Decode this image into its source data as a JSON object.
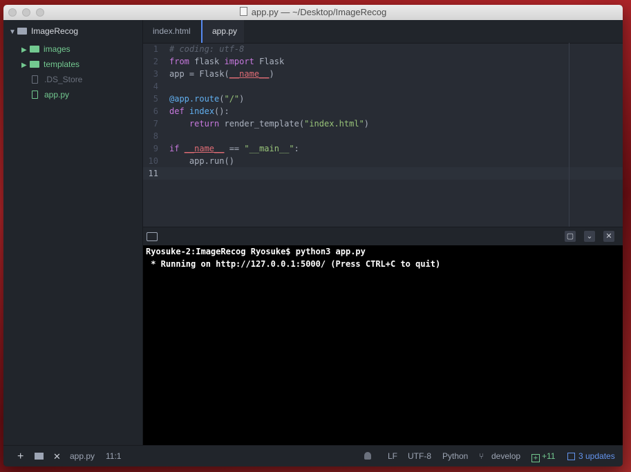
{
  "window": {
    "title": "app.py — ~/Desktop/ImageRecog"
  },
  "tree": {
    "root": "ImageRecog",
    "items": [
      {
        "label": "images",
        "type": "folder"
      },
      {
        "label": "templates",
        "type": "folder"
      },
      {
        "label": ".DS_Store",
        "type": "file"
      },
      {
        "label": "app.py",
        "type": "file"
      }
    ]
  },
  "tabs": [
    {
      "label": "index.html",
      "active": false
    },
    {
      "label": "app.py",
      "active": true
    }
  ],
  "editor": {
    "line_numbers": [
      "1",
      "2",
      "3",
      "4",
      "5",
      "6",
      "7",
      "8",
      "9",
      "10",
      "11"
    ],
    "current_line": "11"
  },
  "terminal": {
    "lines": [
      "Ryosuke-2:ImageRecog Ryosuke$ python3 app.py",
      " * Running on http://127.0.0.1:5000/ (Press CTRL+C to quit)"
    ]
  },
  "status": {
    "file": "app.py",
    "cursor": "11:1",
    "line_ending": "LF",
    "encoding": "UTF-8",
    "grammar": "Python",
    "branch": "develop",
    "diff": "+11",
    "updates": "3 updates"
  },
  "colors": {
    "accent": "#568af2",
    "git_added": "#73c990",
    "updates": "#6494ed"
  }
}
